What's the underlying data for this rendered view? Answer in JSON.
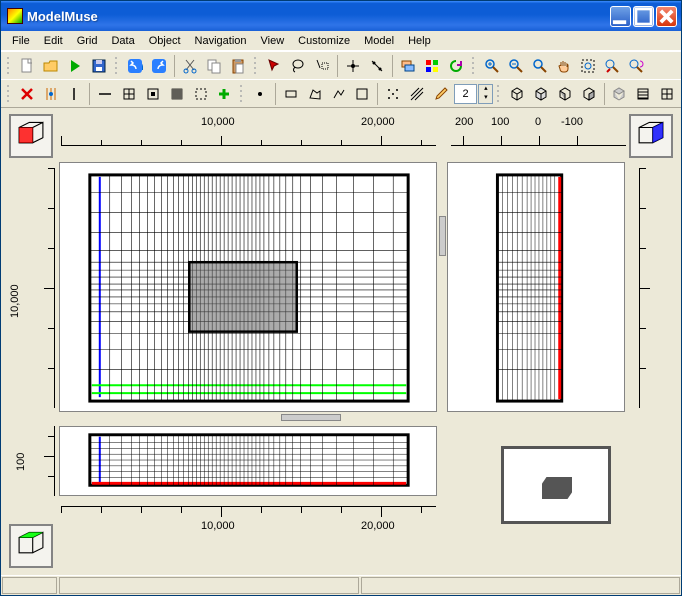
{
  "window": {
    "title": "ModelMuse"
  },
  "menu": {
    "items": [
      "File",
      "Edit",
      "Grid",
      "Data",
      "Object",
      "Navigation",
      "View",
      "Customize",
      "Model",
      "Help"
    ]
  },
  "toolbars": {
    "row1": {
      "new_icon": "new-file",
      "open_icon": "open-folder",
      "run_icon": "run",
      "save_icon": "save",
      "undo_icon": "undo",
      "redo_icon": "redo",
      "cut_icon": "cut",
      "copy_icon": "copy",
      "paste_icon": "paste",
      "select_icon": "select-arrow",
      "lasso_icon": "lasso",
      "point_icon": "point-select",
      "crosshair_icon": "crosshair",
      "snap_icon": "snap",
      "layers_icon": "layers",
      "colors_icon": "colors",
      "refresh_icon": "refresh",
      "zoomin_icon": "zoom-in",
      "zoomout_icon": "zoom-out",
      "zoomfit_icon": "zoom-fit",
      "pan_icon": "pan-hand",
      "zoomregion_icon": "zoom-region",
      "zoomrestore_icon": "zoom-restore",
      "zoomundo_icon": "zoom-undo"
    },
    "row2": {
      "delete_icon": "delete-x",
      "snap1_icon": "snap-grid",
      "vline_icon": "vline",
      "hline_icon": "hline",
      "gridlines_icon": "gridlines",
      "gridbox_icon": "gridbox",
      "gridfine_icon": "gridfine",
      "griddash_icon": "griddash",
      "gridadd_icon": "add-plus",
      "shape_point_icon": "shape-point",
      "shape_rect_icon": "shape-rect",
      "shape_poly_icon": "shape-poly",
      "shape_line_icon": "shape-line",
      "shape_scribble_icon": "shape-scribble",
      "shape_dots_icon": "shape-dots",
      "shape_hatch_icon": "shape-hatch",
      "pencil_icon": "pencil",
      "spin_value": "2",
      "view_iso1_icon": "view-iso1",
      "view_iso2_icon": "view-iso2",
      "view_xy_icon": "view-xy",
      "view_yz_icon": "view-yz",
      "view_wire_icon": "view-wire",
      "view_solid_icon": "view-solid",
      "view_gridtoggle_icon": "view-gridtoggle"
    }
  },
  "ruler_top_main": {
    "labels": [
      "10,000",
      "20,000"
    ]
  },
  "ruler_top_side": {
    "labels": [
      "200",
      "100",
      "0",
      "-100"
    ]
  },
  "ruler_left_main": {
    "labels": [
      "10,000"
    ]
  },
  "ruler_left_bottom": {
    "labels": [
      "100"
    ]
  },
  "ruler_bottom": {
    "labels": [
      "10,000",
      "20,000"
    ]
  },
  "accent_colors": {
    "red": "#ff0000",
    "green": "#00ff00",
    "blue": "#0000ff"
  }
}
